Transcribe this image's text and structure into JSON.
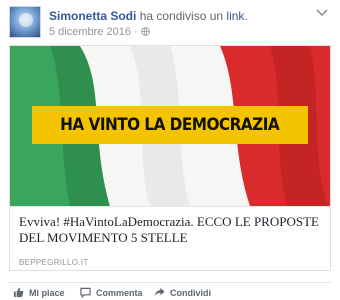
{
  "post": {
    "author": "Simonetta Sodi",
    "shared_text": "ha condiviso un",
    "shared_link": "link",
    "shared_suffix": ".",
    "date": "5 dicembre 2016",
    "dot": "·",
    "privacy_icon": "globe-icon",
    "menu_icon": "chevron-down-icon"
  },
  "link_card": {
    "image_banner": "HA VINTO LA DEMOCRAZIA",
    "title": "Evviva! #HaVintoLaDemocrazia. ECCO LE PROPOSTE DEL MOVIMENTO 5 STELLE",
    "source": "BEPPEGRILLO.IT"
  },
  "actions": {
    "like": {
      "label": "Mi piace",
      "icon": "thumbs-up-icon"
    },
    "comment": {
      "label": "Commenta",
      "icon": "comment-icon"
    },
    "share": {
      "label": "Condividi",
      "icon": "share-icon"
    }
  },
  "colors": {
    "link_blue": "#365899",
    "meta_gray": "#90949c",
    "banner_yellow": "#f5c400",
    "flag_green": "#2f8f4e",
    "flag_red": "#d92b2b"
  }
}
